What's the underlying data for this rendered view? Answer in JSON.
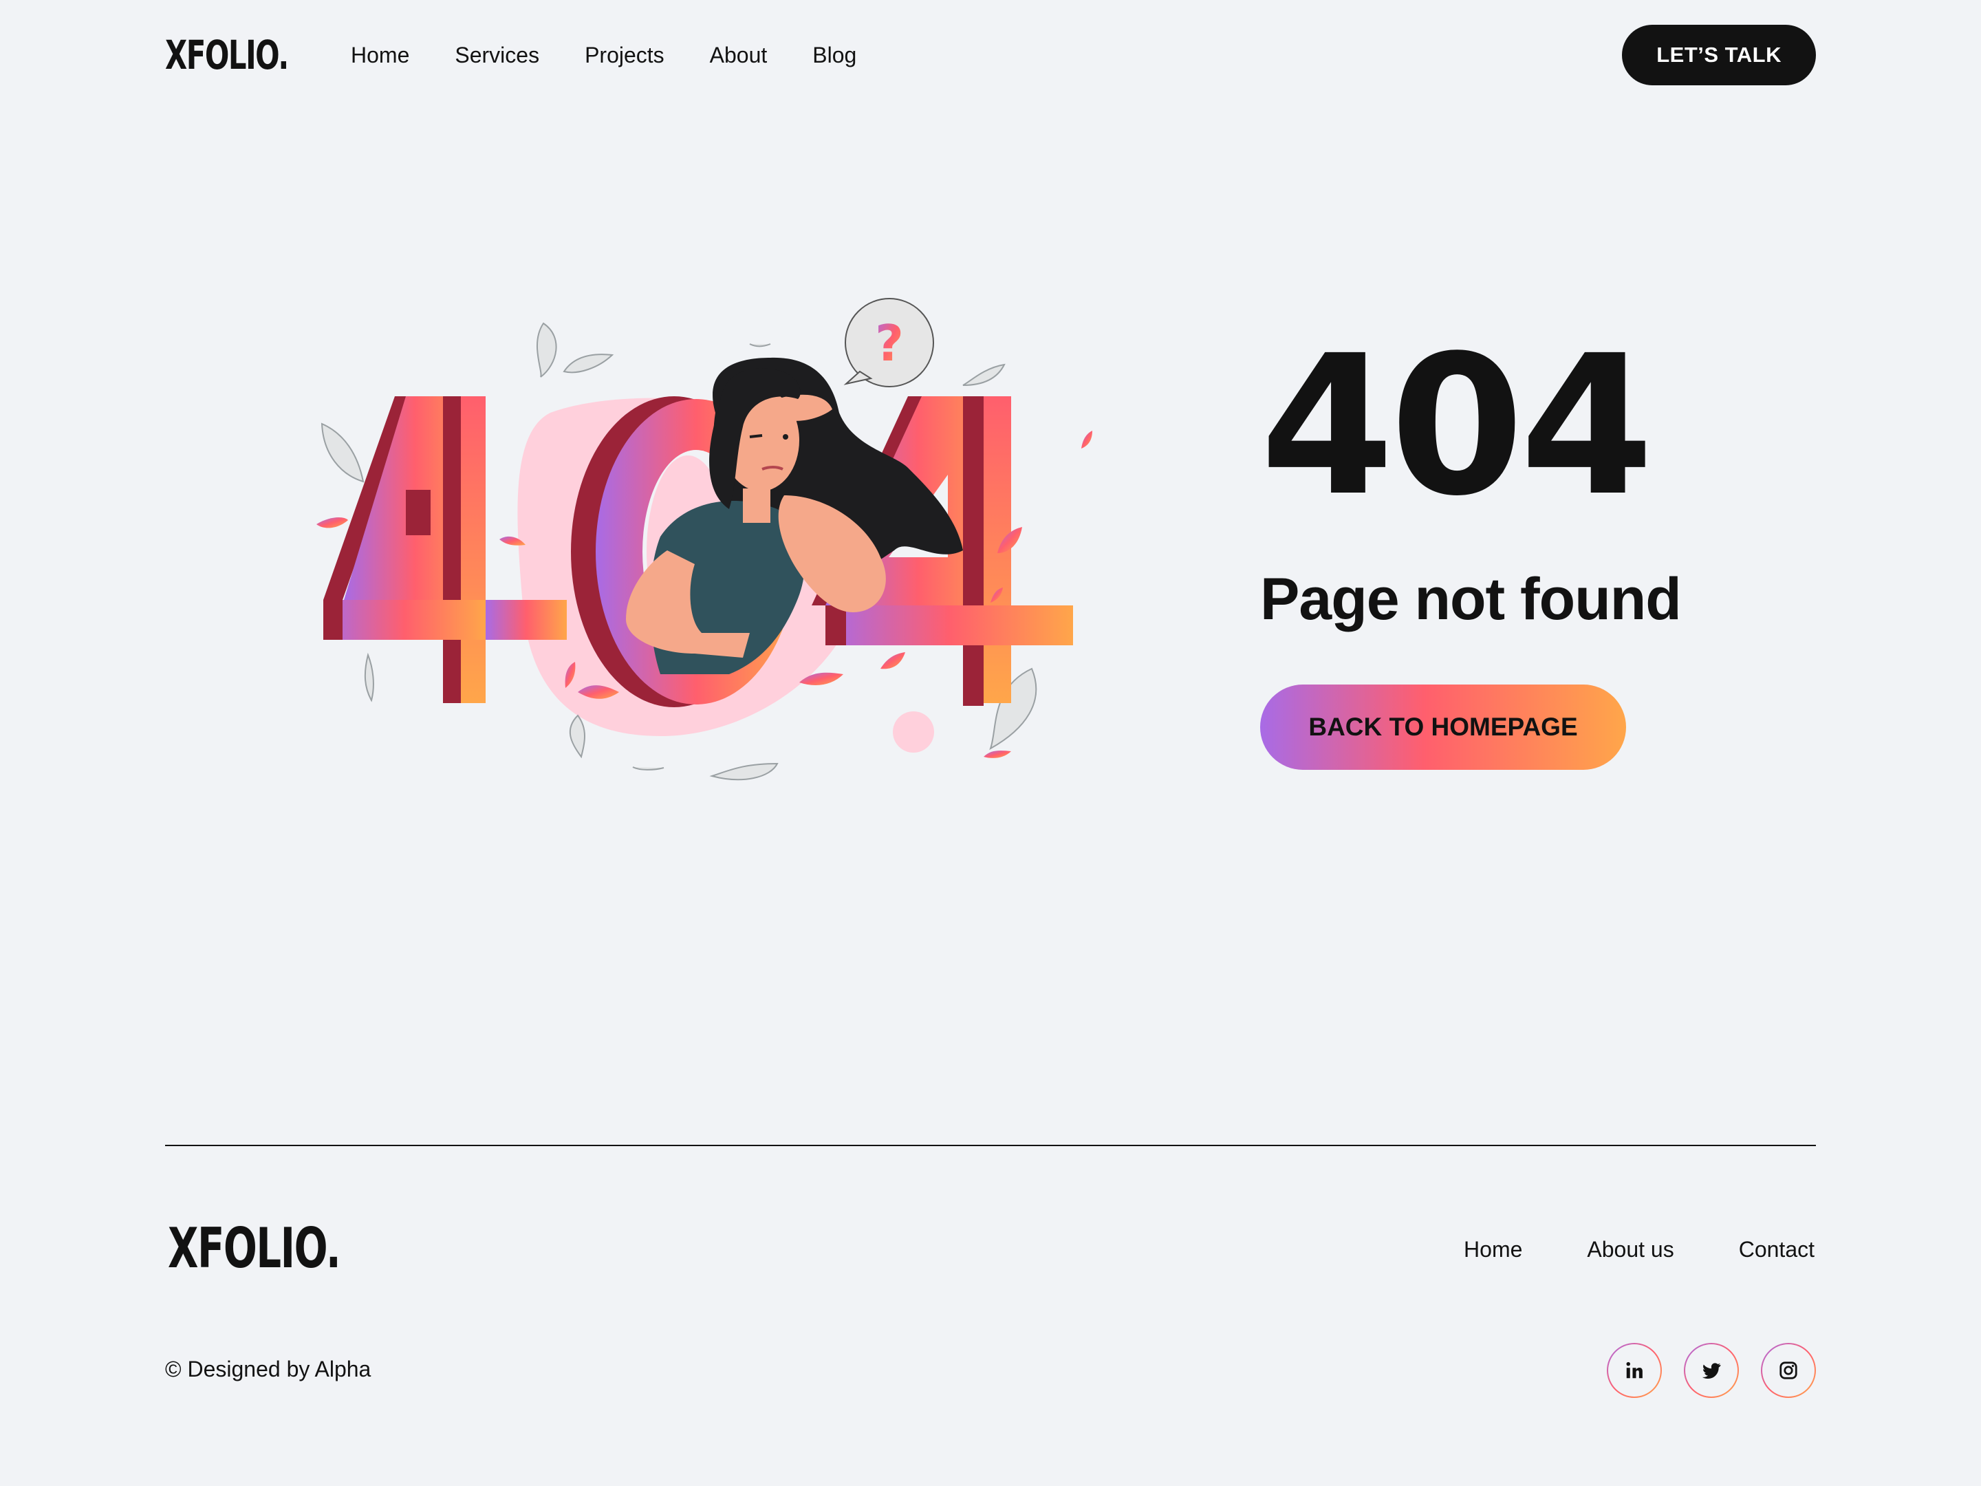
{
  "header": {
    "logo": "XFOLIO.",
    "nav": [
      "Home",
      "Services",
      "Projects",
      "About",
      "Blog"
    ],
    "cta": "LET’S TALK"
  },
  "hero": {
    "illustration_text": "404",
    "question_mark": "?",
    "code": "404",
    "message": "Page not found",
    "button": "BACK TO HOMEPAGE"
  },
  "footer": {
    "logo": "XFOLIO.",
    "links": [
      "Home",
      "About us",
      "Contact"
    ],
    "copyright": "© Designed by Alpha",
    "socials": [
      "linkedin-icon",
      "twitter-icon",
      "instagram-icon"
    ]
  },
  "colors": {
    "background": "#f1f3f6",
    "text": "#121212",
    "gradient_start": "#a86be6",
    "gradient_mid": "#ff5f6d",
    "gradient_end": "#ffa64a",
    "digit_shadow": "#9b2338",
    "blob": "#ffd0dc"
  }
}
